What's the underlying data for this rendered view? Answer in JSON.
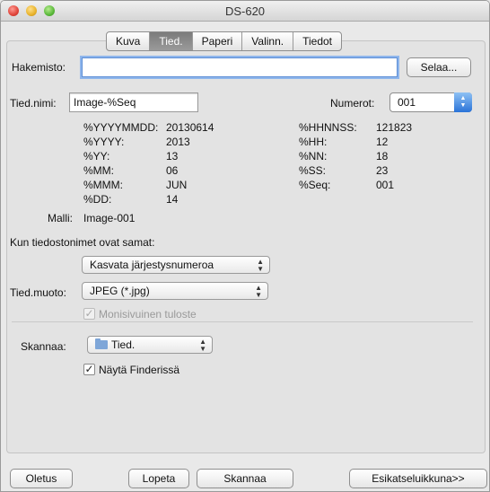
{
  "window": {
    "title": "DS-620"
  },
  "tabs": [
    "Kuva",
    "Tied.",
    "Paperi",
    "Valinn.",
    "Tiedot"
  ],
  "active_tab": "Tied.",
  "directory": {
    "label": "Hakemisto:",
    "value": "",
    "browse_label": "Selaa..."
  },
  "filename": {
    "label": "Tied.nimi:",
    "value": "Image-%Seq"
  },
  "numbering": {
    "label": "Numerot:",
    "value": "001"
  },
  "tokens_left": [
    {
      "key": "%YYYYMMDD:",
      "value": "20130614"
    },
    {
      "key": "%YYYY:",
      "value": "2013"
    },
    {
      "key": "%YY:",
      "value": "13"
    },
    {
      "key": "%MM:",
      "value": "06"
    },
    {
      "key": "%MMM:",
      "value": "JUN"
    },
    {
      "key": "%DD:",
      "value": "14"
    }
  ],
  "tokens_right": [
    {
      "key": "%HHNNSS:",
      "value": "121823"
    },
    {
      "key": "%HH:",
      "value": "12"
    },
    {
      "key": "%NN:",
      "value": "18"
    },
    {
      "key": "%SS:",
      "value": "23"
    },
    {
      "key": "%Seq:",
      "value": "001"
    }
  ],
  "sample": {
    "label": "Malli:",
    "value": "Image-001"
  },
  "same_name": {
    "label": "Kun tiedostonimet ovat samat:",
    "option": "Kasvata järjestysnumeroa"
  },
  "file_format": {
    "label": "Tied.muoto:",
    "option": "JPEG (*.jpg)"
  },
  "multipage": {
    "label": "Monisivuinen tuloste",
    "checked": true,
    "enabled": false
  },
  "scan_to": {
    "label": "Skannaa:",
    "option": "Tied."
  },
  "show_in_finder": {
    "label": "Näytä Finderissä",
    "checked": true
  },
  "buttons": {
    "defaults": "Oletus",
    "quit": "Lopeta",
    "scan": "Skannaa",
    "preview": "Esikatseluikkuna>>"
  }
}
